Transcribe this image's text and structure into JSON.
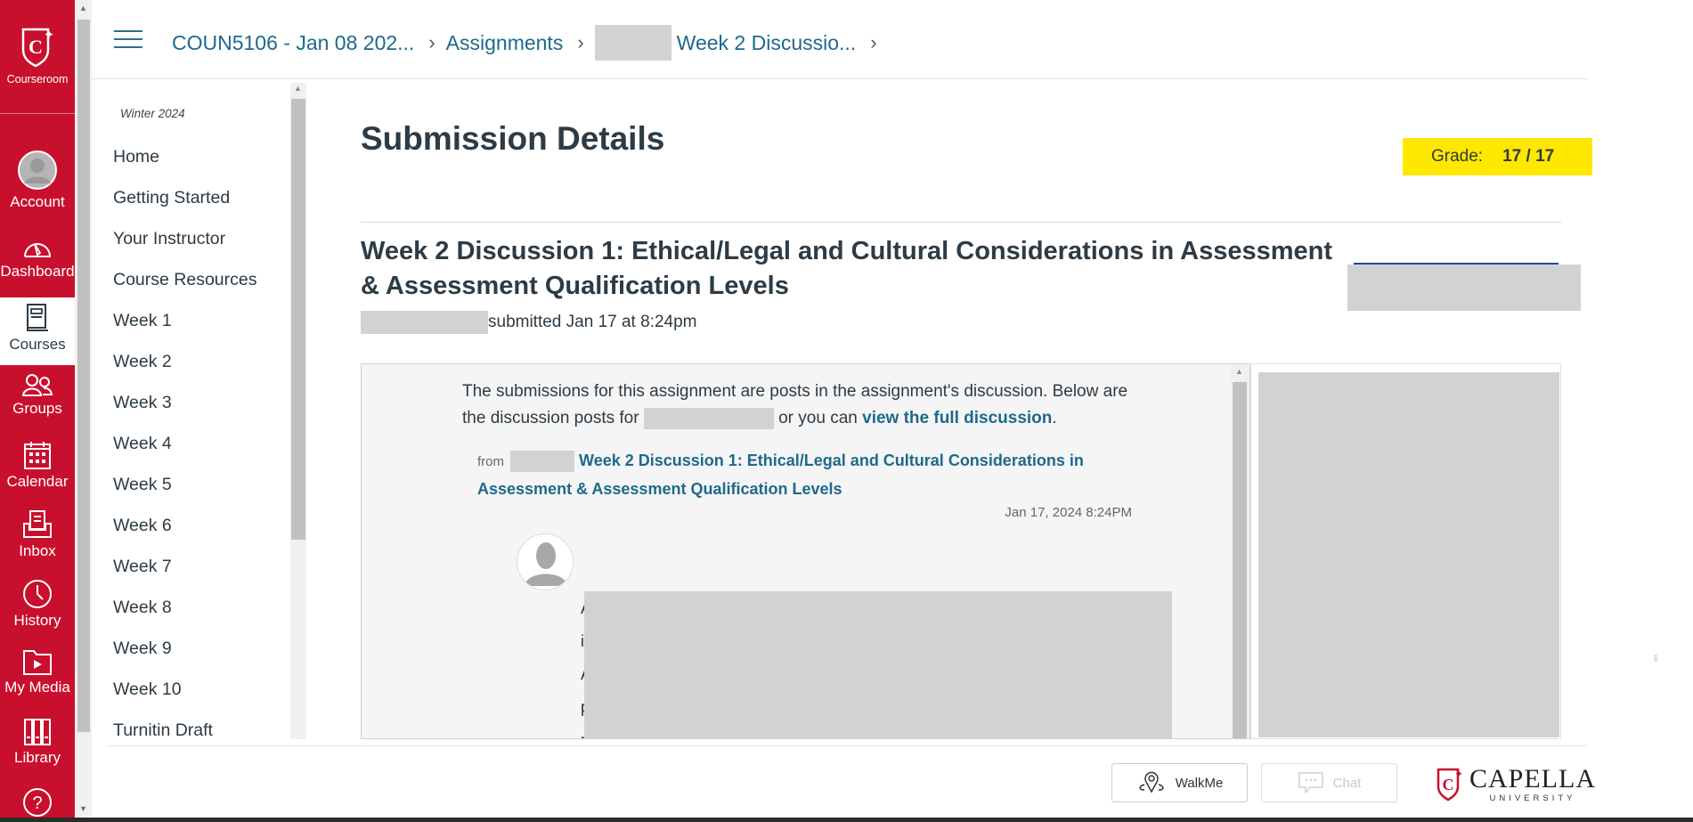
{
  "global_nav": {
    "logo_label": "Courseroom",
    "items": [
      {
        "label": "Account",
        "icon": "account-avatar-icon"
      },
      {
        "label": "Dashboard",
        "icon": "dashboard-gauge-icon"
      },
      {
        "label": "Courses",
        "icon": "courses-book-icon",
        "active": true
      },
      {
        "label": "Groups",
        "icon": "groups-icon"
      },
      {
        "label": "Calendar",
        "icon": "calendar-icon"
      },
      {
        "label": "Inbox",
        "icon": "inbox-icon"
      },
      {
        "label": "History",
        "icon": "history-clock-icon"
      },
      {
        "label": "My Media",
        "icon": "my-media-folder-icon"
      },
      {
        "label": "Library",
        "icon": "library-books-icon"
      },
      {
        "label": "",
        "icon": "help-question-icon"
      }
    ]
  },
  "breadcrumb": {
    "items": [
      {
        "label": "COUN5106 - Jan 08 202..."
      },
      {
        "label": "Assignments"
      },
      {
        "label": "Week 2 Discussio..."
      }
    ]
  },
  "course_nav": {
    "term": "Winter 2024",
    "items": [
      "Home",
      "Getting Started",
      "Your Instructor",
      "Course Resources",
      "Week 1",
      "Week 2",
      "Week 3",
      "Week 4",
      "Week 5",
      "Week 6",
      "Week 7",
      "Week 8",
      "Week 9",
      "Week 10",
      "Turnitin Draft"
    ]
  },
  "main": {
    "page_title": "Submission Details",
    "grade_label": "Grade:",
    "grade_value": "17 / 17",
    "assignment_title": "Week 2 Discussion 1: Ethical/Legal and Cultural Considerations in Assessment & Assessment Qualification Levels",
    "submitted_text": "submitted Jan 17 at 8:24pm"
  },
  "discussion_frame": {
    "intro_part1": "The submissions for this assignment are posts in the assignment's discussion. Below are the discussion posts for",
    "intro_part2": "or you can",
    "full_discussion_link": "view the full discussion",
    "intro_end": ".",
    "from_label": "from",
    "topic_link": "Week 2 Discussion 1: Ethical/Legal and Cultural Considerations in Assessment & Assessment Qualification Levels",
    "post_date": "Jan 17, 2024 8:24PM",
    "post_visible_letters": [
      "A",
      "i",
      "A",
      "p",
      "r"
    ]
  },
  "footer": {
    "walkme_label": "WalkMe",
    "chat_label": "Chat",
    "brand_name": "CAPELLA",
    "brand_sub": "UNIVERSITY"
  },
  "colors": {
    "brand_red": "#c8102e",
    "link_blue": "#1d6a8b",
    "grade_highlight": "#ffe800",
    "redaction_gray": "#d1d2d4"
  }
}
